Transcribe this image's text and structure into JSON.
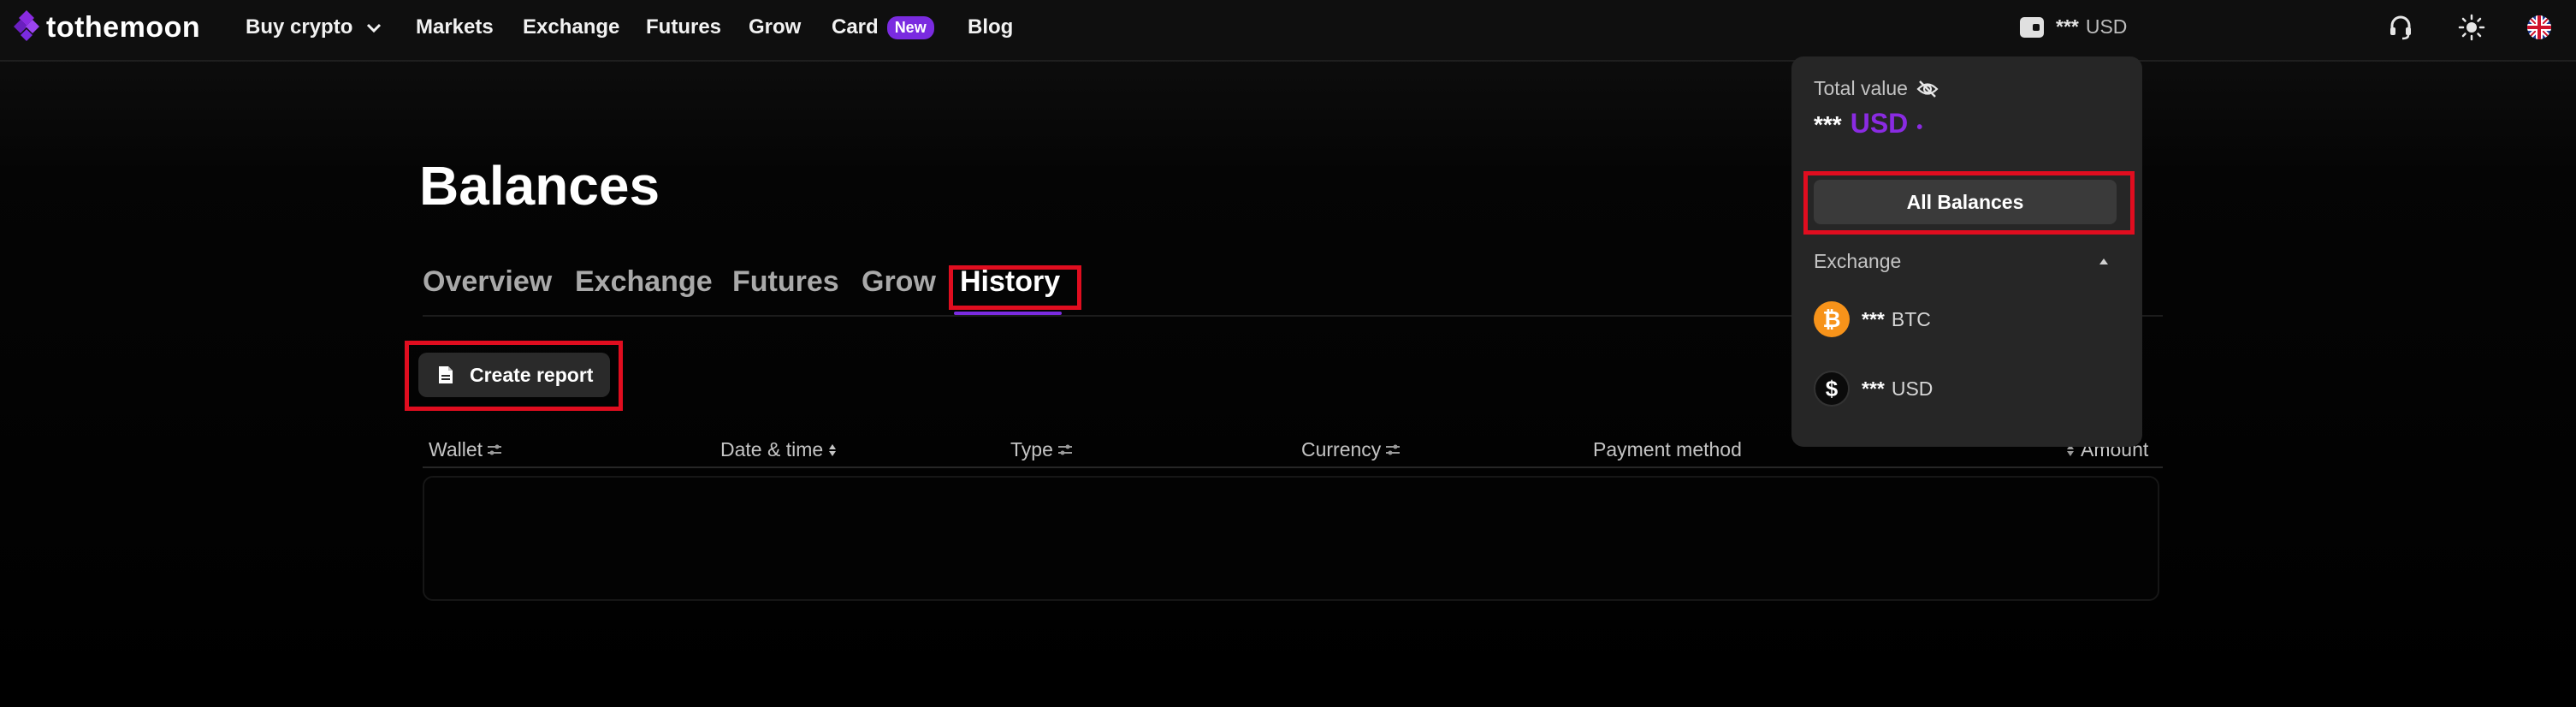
{
  "nav": {
    "logo_text": "tothemoon",
    "items": [
      {
        "label": "Buy crypto"
      },
      {
        "label": "Markets"
      },
      {
        "label": "Exchange"
      },
      {
        "label": "Futures"
      },
      {
        "label": "Grow"
      },
      {
        "label": "Card"
      },
      {
        "label": "Blog"
      }
    ],
    "card_badge": "New",
    "wallet_masked": "***",
    "wallet_currency": "USD"
  },
  "page": {
    "title": "Balances",
    "tabs": [
      {
        "label": "Overview"
      },
      {
        "label": "Exchange"
      },
      {
        "label": "Futures"
      },
      {
        "label": "Grow"
      },
      {
        "label": "History",
        "active": true
      }
    ],
    "create_report_label": "Create report",
    "table": {
      "columns": [
        {
          "label": "Wallet"
        },
        {
          "label": "Date & time"
        },
        {
          "label": "Type"
        },
        {
          "label": "Currency"
        },
        {
          "label": "Payment method"
        },
        {
          "label": "Amount"
        }
      ],
      "rows": []
    }
  },
  "dropdown": {
    "total_value_label": "Total value",
    "total_masked": "***",
    "total_currency": "USD",
    "all_balances_label": "All Balances",
    "section_label": "Exchange",
    "assets": [
      {
        "masked": "***",
        "currency": "BTC",
        "icon": "bitcoin-icon"
      },
      {
        "masked": "***",
        "currency": "USD",
        "icon": "dollar-icon"
      }
    ]
  },
  "colors": {
    "accent": "#7a2be0",
    "highlight": "#e00d1f",
    "bitcoin": "#f7931a"
  }
}
